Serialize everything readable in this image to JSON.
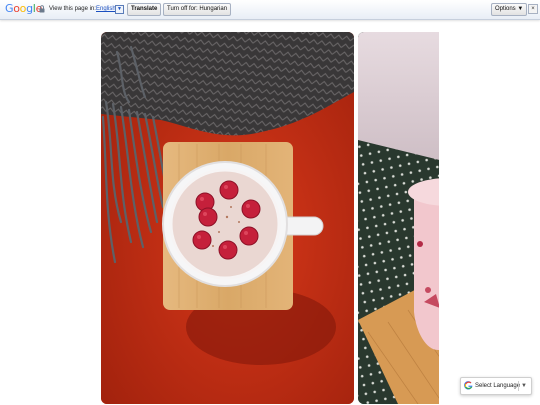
{
  "translate_bar": {
    "logo_letters": [
      "G",
      "o",
      "o",
      "g",
      "l",
      "e"
    ],
    "view_text": "View this page in:",
    "language": "English",
    "dropdown_arrow": "▼",
    "translate_button": "Translate",
    "turn_off_button": "Turn off for: Hungarian",
    "options_button": "Options ▼",
    "close_button": "×",
    "lock_icon": "lock-icon"
  },
  "gallery": {
    "photos": [
      {
        "subject": "latte-with-raspberries"
      },
      {
        "subject": "pink-cup-on-polka-dot-cloth"
      }
    ]
  },
  "language_widget": {
    "label": "Select Language",
    "arrow": "▼",
    "icon": "google-g-icon"
  },
  "colors": {
    "bar_border": "#c6cfdc",
    "link_blue": "#1a4fc0",
    "table_red": "#c52c14",
    "scarf_grey": "#3d3b3c",
    "cloth_green": "#283a2f"
  }
}
